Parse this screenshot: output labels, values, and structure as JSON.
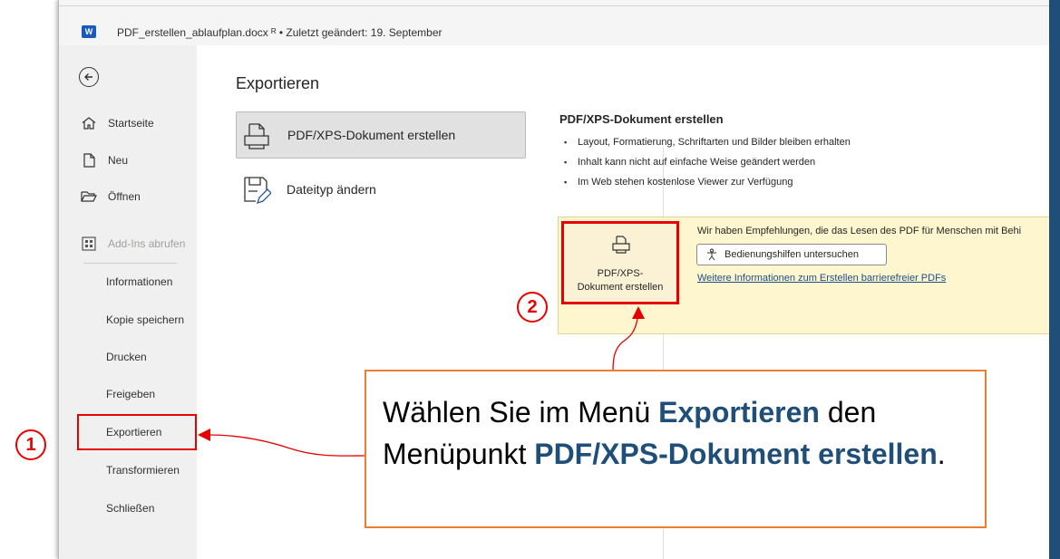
{
  "window": {
    "app_icon": "word-icon",
    "app_icon_letter": "W",
    "title": "PDF_erstellen_ablaufplan.docx  ᴿ  • Zuletzt geändert: 19. September"
  },
  "backstage_nav": {
    "back_icon": "back-arrow-icon",
    "items": [
      {
        "label": "Startseite",
        "icon": "home-icon"
      },
      {
        "label": "Neu",
        "icon": "new-document-icon"
      },
      {
        "label": "Öffnen",
        "icon": "folder-open-icon"
      },
      {
        "label": "Add-Ins abrufen",
        "icon": "add-ins-icon",
        "disabled": true
      },
      {
        "label": "Informationen"
      },
      {
        "label": "Kopie speichern"
      },
      {
        "label": "Drucken"
      },
      {
        "label": "Freigeben"
      },
      {
        "label": "Exportieren",
        "highlighted": true
      },
      {
        "label": "Transformieren"
      },
      {
        "label": "Schließen"
      }
    ]
  },
  "export": {
    "section_title": "Exportieren",
    "options": [
      {
        "label": "PDF/XPS-Dokument erstellen",
        "icon": "pdf-document-icon",
        "selected": true
      },
      {
        "label": "Dateityp ändern",
        "icon": "change-filetype-icon"
      }
    ],
    "detail": {
      "title": "PDF/XPS-Dokument erstellen",
      "bullets": [
        "Layout, Formatierung, Schriftarten und Bilder bleiben erhalten",
        "Inhalt kann nicht auf einfache Weise geändert werden",
        "Im Web stehen kostenlose Viewer zur Verfügung"
      ]
    },
    "create_button": {
      "line1": "PDF/XPS-",
      "line2": "Dokument erstellen",
      "icon": "pdf-create-icon"
    },
    "recommendation": {
      "text": "Wir haben Empfehlungen, die das Lesen des PDF für Menschen mit Behi",
      "accessibility_button": "Bedienungshilfen untersuchen",
      "accessibility_icon": "accessibility-icon",
      "link": "Weitere Informationen zum Erstellen barrierefreier PDFs"
    }
  },
  "annotations": {
    "step1": "1",
    "step2": "2",
    "callout": {
      "part1": "Wählen Sie im Menü ",
      "emph1": "Exportieren",
      "part2": " den Menüpunkt ",
      "emph2": "PDF/XPS-Dokument erstellen",
      "part3": "."
    },
    "colors": {
      "highlight": "#e60000",
      "callout_border": "#ed7d31",
      "emphasis": "#1f4e79"
    }
  }
}
